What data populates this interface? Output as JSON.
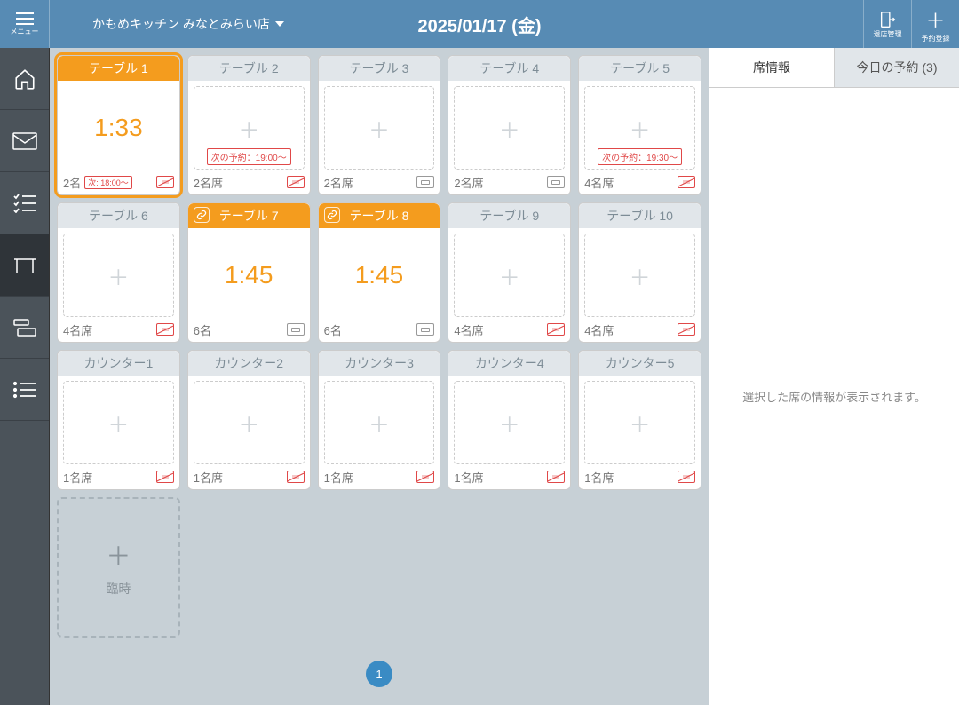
{
  "header": {
    "menu_label": "メニュー",
    "store_name": "かもめキッチン みなとみらい店",
    "date": "2025/01/17 (金)",
    "exit_label": "退店管理",
    "new_reservation_label": "予約登録"
  },
  "tables": [
    {
      "name": "テーブル 1",
      "header_orange": true,
      "selected": true,
      "time": "1:33",
      "next_small": "次: 18:00～",
      "footer_main": "2名",
      "no_smoking": true
    },
    {
      "name": "テーブル 2",
      "next_res": "次の予約：19:00～",
      "footer_main": "2名席",
      "no_smoking": true
    },
    {
      "name": "テーブル 3",
      "footer_main": "2名席",
      "gray_icon": true
    },
    {
      "name": "テーブル 4",
      "footer_main": "2名席",
      "gray_icon": true
    },
    {
      "name": "テーブル 5",
      "next_res": "次の予約：19:30～",
      "footer_main": "4名席",
      "no_smoking": true
    },
    {
      "name": "テーブル 6",
      "footer_main": "4名席",
      "no_smoking": true
    },
    {
      "name": "テーブル 7",
      "header_orange": true,
      "pin": true,
      "time": "1:45",
      "footer_main": "6名",
      "gray_icon": true
    },
    {
      "name": "テーブル 8",
      "header_orange": true,
      "pin": true,
      "time": "1:45",
      "footer_main": "6名",
      "gray_icon": true
    },
    {
      "name": "テーブル 9",
      "footer_main": "4名席",
      "no_smoking": true
    },
    {
      "name": "テーブル 10",
      "footer_main": "4名席",
      "no_smoking": true
    },
    {
      "name": "カウンター1",
      "footer_main": "1名席",
      "no_smoking": true
    },
    {
      "name": "カウンター2",
      "footer_main": "1名席",
      "no_smoking": true
    },
    {
      "name": "カウンター3",
      "footer_main": "1名席",
      "no_smoking": true
    },
    {
      "name": "カウンター4",
      "footer_main": "1名席",
      "no_smoking": true
    },
    {
      "name": "カウンター5",
      "footer_main": "1名席",
      "no_smoking": true
    }
  ],
  "add_card_label": "臨時",
  "pager": {
    "current": "1"
  },
  "right": {
    "tab_seat_info": "席情報",
    "tab_today": "今日の予約 (3)",
    "placeholder": "選択した席の情報が表示されます。"
  }
}
